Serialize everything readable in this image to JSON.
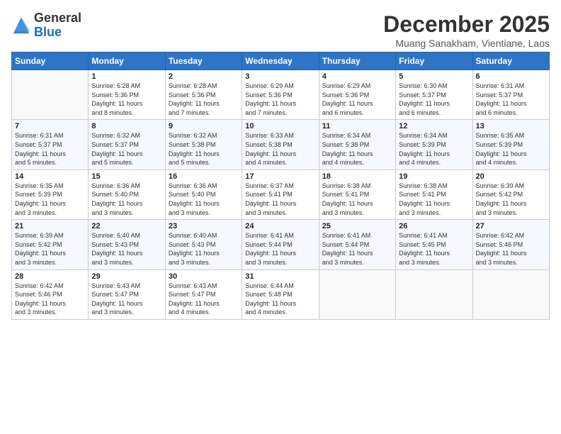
{
  "header": {
    "logo_general": "General",
    "logo_blue": "Blue",
    "month_title": "December 2025",
    "location": "Muang Sanakham, Vientiane, Laos"
  },
  "days_of_week": [
    "Sunday",
    "Monday",
    "Tuesday",
    "Wednesday",
    "Thursday",
    "Friday",
    "Saturday"
  ],
  "weeks": [
    [
      {
        "day": "",
        "info": ""
      },
      {
        "day": "1",
        "info": "Sunrise: 6:28 AM\nSunset: 5:36 PM\nDaylight: 11 hours\nand 8 minutes."
      },
      {
        "day": "2",
        "info": "Sunrise: 6:28 AM\nSunset: 5:36 PM\nDaylight: 11 hours\nand 7 minutes."
      },
      {
        "day": "3",
        "info": "Sunrise: 6:29 AM\nSunset: 5:36 PM\nDaylight: 11 hours\nand 7 minutes."
      },
      {
        "day": "4",
        "info": "Sunrise: 6:29 AM\nSunset: 5:36 PM\nDaylight: 11 hours\nand 6 minutes."
      },
      {
        "day": "5",
        "info": "Sunrise: 6:30 AM\nSunset: 5:37 PM\nDaylight: 11 hours\nand 6 minutes."
      },
      {
        "day": "6",
        "info": "Sunrise: 6:31 AM\nSunset: 5:37 PM\nDaylight: 11 hours\nand 6 minutes."
      }
    ],
    [
      {
        "day": "7",
        "info": "Sunrise: 6:31 AM\nSunset: 5:37 PM\nDaylight: 11 hours\nand 5 minutes."
      },
      {
        "day": "8",
        "info": "Sunrise: 6:32 AM\nSunset: 5:37 PM\nDaylight: 11 hours\nand 5 minutes."
      },
      {
        "day": "9",
        "info": "Sunrise: 6:32 AM\nSunset: 5:38 PM\nDaylight: 11 hours\nand 5 minutes."
      },
      {
        "day": "10",
        "info": "Sunrise: 6:33 AM\nSunset: 5:38 PM\nDaylight: 11 hours\nand 4 minutes."
      },
      {
        "day": "11",
        "info": "Sunrise: 6:34 AM\nSunset: 5:38 PM\nDaylight: 11 hours\nand 4 minutes."
      },
      {
        "day": "12",
        "info": "Sunrise: 6:34 AM\nSunset: 5:39 PM\nDaylight: 11 hours\nand 4 minutes."
      },
      {
        "day": "13",
        "info": "Sunrise: 6:35 AM\nSunset: 5:39 PM\nDaylight: 11 hours\nand 4 minutes."
      }
    ],
    [
      {
        "day": "14",
        "info": "Sunrise: 6:35 AM\nSunset: 5:39 PM\nDaylight: 11 hours\nand 3 minutes."
      },
      {
        "day": "15",
        "info": "Sunrise: 6:36 AM\nSunset: 5:40 PM\nDaylight: 11 hours\nand 3 minutes."
      },
      {
        "day": "16",
        "info": "Sunrise: 6:36 AM\nSunset: 5:40 PM\nDaylight: 11 hours\nand 3 minutes."
      },
      {
        "day": "17",
        "info": "Sunrise: 6:37 AM\nSunset: 5:41 PM\nDaylight: 11 hours\nand 3 minutes."
      },
      {
        "day": "18",
        "info": "Sunrise: 6:38 AM\nSunset: 5:41 PM\nDaylight: 11 hours\nand 3 minutes."
      },
      {
        "day": "19",
        "info": "Sunrise: 6:38 AM\nSunset: 5:41 PM\nDaylight: 11 hours\nand 3 minutes."
      },
      {
        "day": "20",
        "info": "Sunrise: 6:39 AM\nSunset: 5:42 PM\nDaylight: 11 hours\nand 3 minutes."
      }
    ],
    [
      {
        "day": "21",
        "info": "Sunrise: 6:39 AM\nSunset: 5:42 PM\nDaylight: 11 hours\nand 3 minutes."
      },
      {
        "day": "22",
        "info": "Sunrise: 6:40 AM\nSunset: 5:43 PM\nDaylight: 11 hours\nand 3 minutes."
      },
      {
        "day": "23",
        "info": "Sunrise: 6:40 AM\nSunset: 5:43 PM\nDaylight: 11 hours\nand 3 minutes."
      },
      {
        "day": "24",
        "info": "Sunrise: 6:41 AM\nSunset: 5:44 PM\nDaylight: 11 hours\nand 3 minutes."
      },
      {
        "day": "25",
        "info": "Sunrise: 6:41 AM\nSunset: 5:44 PM\nDaylight: 11 hours\nand 3 minutes."
      },
      {
        "day": "26",
        "info": "Sunrise: 6:41 AM\nSunset: 5:45 PM\nDaylight: 11 hours\nand 3 minutes."
      },
      {
        "day": "27",
        "info": "Sunrise: 6:42 AM\nSunset: 5:46 PM\nDaylight: 11 hours\nand 3 minutes."
      }
    ],
    [
      {
        "day": "28",
        "info": "Sunrise: 6:42 AM\nSunset: 5:46 PM\nDaylight: 11 hours\nand 3 minutes."
      },
      {
        "day": "29",
        "info": "Sunrise: 6:43 AM\nSunset: 5:47 PM\nDaylight: 11 hours\nand 3 minutes."
      },
      {
        "day": "30",
        "info": "Sunrise: 6:43 AM\nSunset: 5:47 PM\nDaylight: 11 hours\nand 4 minutes."
      },
      {
        "day": "31",
        "info": "Sunrise: 6:44 AM\nSunset: 5:48 PM\nDaylight: 11 hours\nand 4 minutes."
      },
      {
        "day": "",
        "info": ""
      },
      {
        "day": "",
        "info": ""
      },
      {
        "day": "",
        "info": ""
      }
    ]
  ]
}
